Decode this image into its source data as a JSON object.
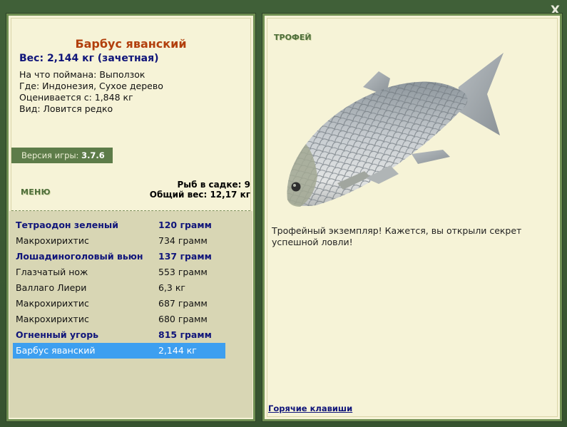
{
  "catch": {
    "fish_name": "Барбус яванский",
    "weight_line": "Вес: 2,144 кг (зачетная)",
    "bait": "На что поймана: Выползок",
    "location": "Где: Индонезия, Сухое дерево",
    "rated": "Оценивается с: 1,848 кг",
    "kind": "Вид: Ловится редко"
  },
  "version": {
    "label": "Версия игры:",
    "value": "3.7.6"
  },
  "menu_label": "МЕНЮ",
  "keepnet": {
    "count_line": "Рыб в садке: 9",
    "total_line": "Общий вес: 12,17 кг"
  },
  "fish_list": [
    {
      "name": "Тетраодон зеленый",
      "weight": "120 грамм",
      "bold": true,
      "selected": false
    },
    {
      "name": "Макрохирихтис",
      "weight": "734 грамм",
      "bold": false,
      "selected": false
    },
    {
      "name": "Лошадиноголовый вьюн",
      "weight": "137 грамм",
      "bold": true,
      "selected": false
    },
    {
      "name": "Глазчатый нож",
      "weight": "553 грамм",
      "bold": false,
      "selected": false
    },
    {
      "name": "Валлаго Лиери",
      "weight": "6,3 кг",
      "bold": false,
      "selected": false
    },
    {
      "name": "Макрохирихтис",
      "weight": "687 грамм",
      "bold": false,
      "selected": false
    },
    {
      "name": "Макрохирихтис",
      "weight": "680 грамм",
      "bold": false,
      "selected": false
    },
    {
      "name": "Огненный угорь",
      "weight": "815 грамм",
      "bold": true,
      "selected": false
    },
    {
      "name": "Барбус яванский",
      "weight": "2,144 кг",
      "bold": false,
      "selected": true
    }
  ],
  "trophy": {
    "label": "ТРОФЕЙ",
    "text": "Трофейный экземпляр! Кажется, вы открыли секрет успешной ловли!"
  },
  "hotkeys_label": "Горячие клавиши",
  "close_label": "X",
  "colors": {
    "background": "#3c5a33",
    "panel": "#f6f3d7",
    "list_background": "#d8d6b4",
    "selected_row": "#3d9ff0",
    "title": "#b23f0c",
    "accent_text": "#10157a"
  }
}
